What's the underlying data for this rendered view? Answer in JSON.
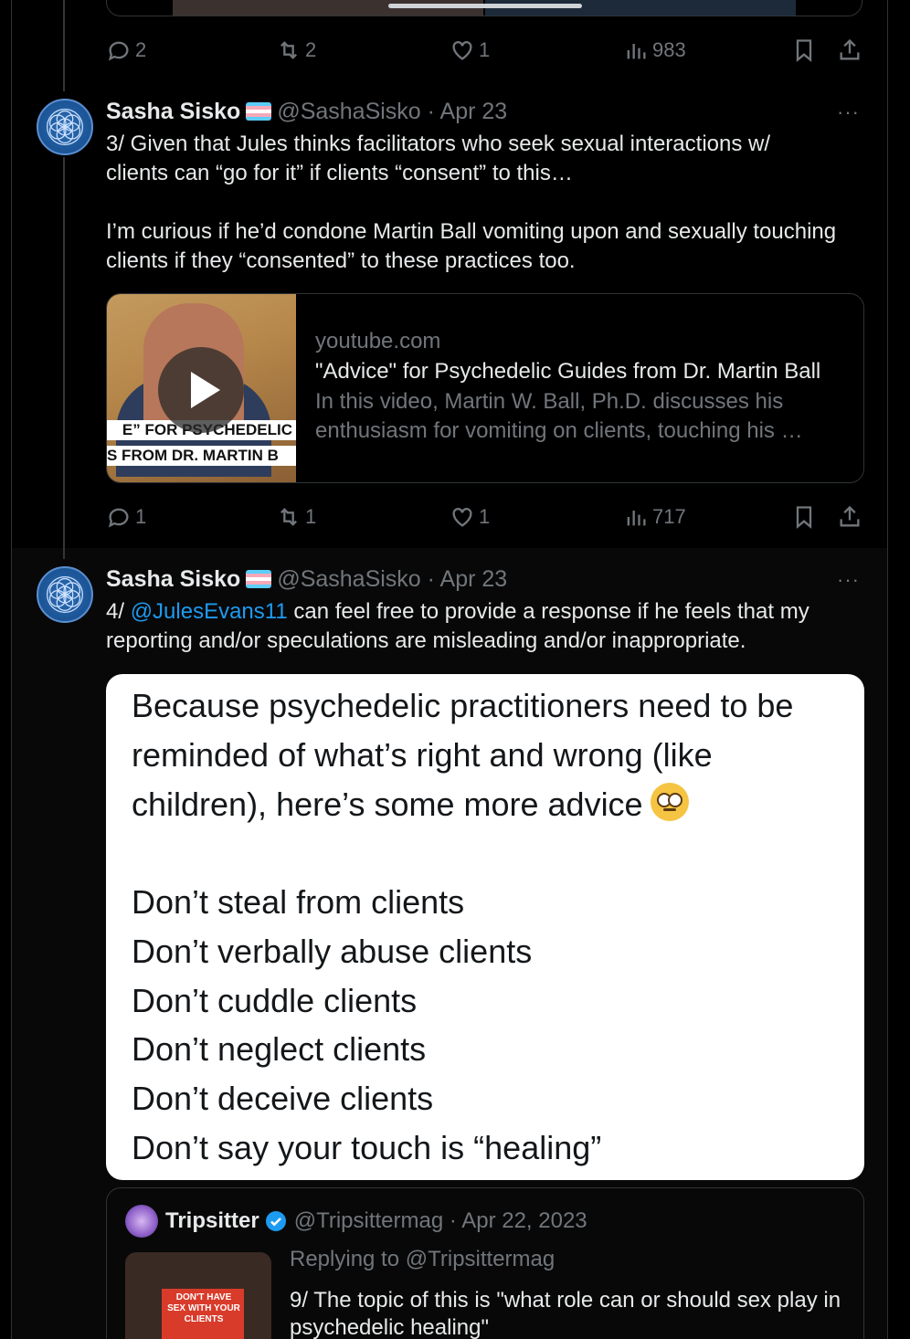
{
  "thread": {
    "prev_actions": {
      "replies": "2",
      "reposts": "2",
      "likes": "1",
      "views": "983"
    },
    "tweet3": {
      "name": "Sasha Sisko",
      "handle_date": "@SashaSisko · Apr 23",
      "more": "···",
      "body_p1": "3/ Given that Jules thinks facilitators who seek sexual interactions w/ clients can “go for it” if clients “consent” to this…",
      "body_p2": "I’m curious if he’d condone Martin Ball vomiting upon and sexually touching clients if they “consented” to these practices too.",
      "card": {
        "domain": "youtube.com",
        "title": "\"Advice\" for Psychedelic Guides from Dr. Martin Ball",
        "desc_line1": "In this video, Martin W. Ball, Ph.D. discusses his",
        "desc_line2": "enthusiasm for vomiting on clients, touching his …",
        "thumb_band1": "E” FOR PSYCHEDELIC",
        "thumb_band2": "S FROM DR. MARTIN B"
      },
      "actions": {
        "replies": "1",
        "reposts": "1",
        "likes": "1",
        "views": "717"
      }
    },
    "tweet4": {
      "name": "Sasha Sisko",
      "handle_date": "@SashaSisko · Apr 23",
      "more": "···",
      "prefix": "4/ ",
      "mention": "@JulesEvans11",
      "body_line1_rest": " can feel free to provide a response if he feels that my",
      "body_line2": "reporting and/or speculations are misleading and/or inappropriate.",
      "image_text": {
        "line1": "Because psychedelic practitioners need to be",
        "line2": "reminded of what’s right and wrong (like",
        "line3": "children), here’s some more advice",
        "list": [
          "Don’t steal from clients",
          "Don’t verbally abuse clients",
          "Don’t cuddle clients",
          "Don’t neglect clients",
          "Don’t deceive clients",
          "Don’t say your touch is “healing”"
        ]
      },
      "quote": {
        "name": "Tripsitter",
        "handle_date": "@Tripsittermag · Apr 22, 2023",
        "reply_to": "Replying to @Tripsittermag",
        "text": "9/ The topic of this is \"what role can or should sex play in psychedelic healing\"",
        "thumb_sign": "DON'T HAVE SEX WITH YOUR CLIENTS"
      }
    }
  },
  "colors": {
    "accent": "#1d9bf0",
    "muted": "#71767b",
    "text": "#e7e9ea",
    "background": "#000000"
  }
}
